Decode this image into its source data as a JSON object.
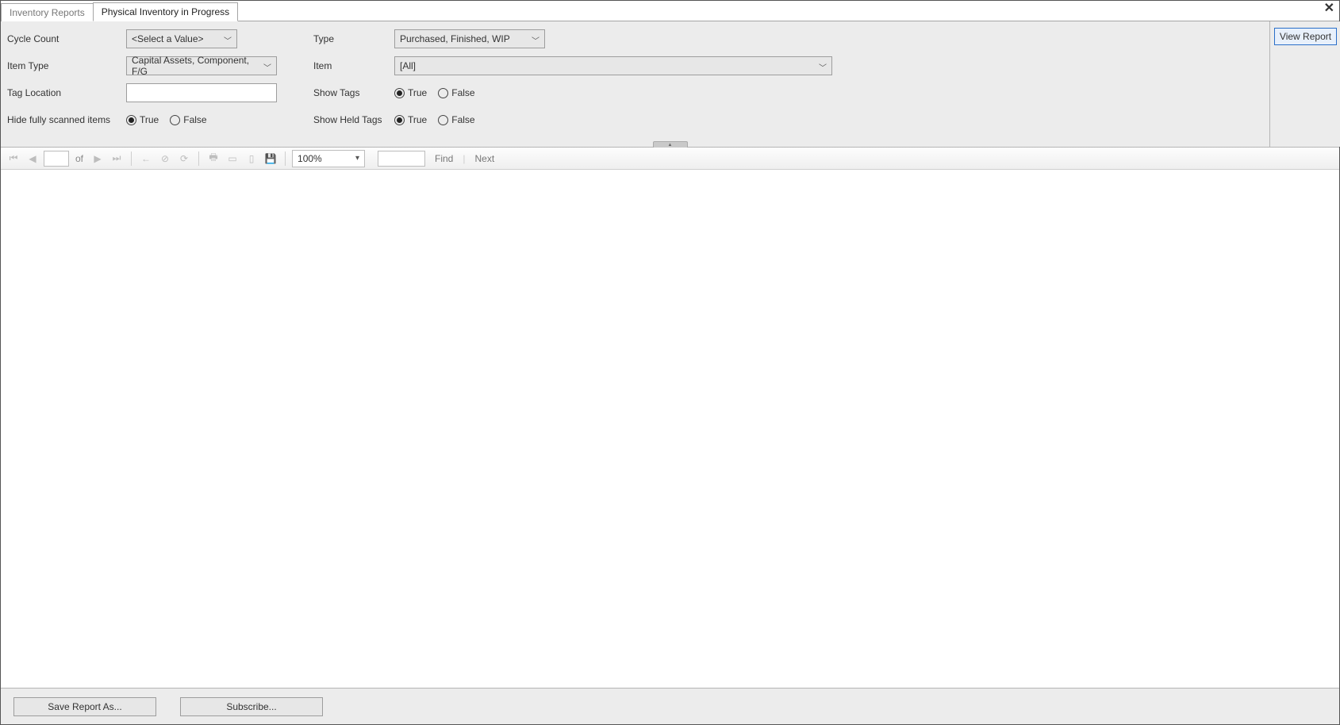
{
  "tabs": {
    "tab1": "Inventory Reports",
    "tab2": "Physical Inventory in Progress",
    "close": "✕"
  },
  "filters": {
    "labels": {
      "cycle_count": "Cycle Count",
      "item_type": "Item Type",
      "tag_location": "Tag Location",
      "hide_scanned": "Hide fully scanned items",
      "type": "Type",
      "item": "Item",
      "show_tags": "Show Tags",
      "show_held_tags": "Show Held Tags"
    },
    "values": {
      "cycle_count": "<Select a Value>",
      "item_type": "Capital Assets, Component, F/G",
      "tag_location": "",
      "type": "Purchased, Finished, WIP",
      "item": "[All]"
    },
    "radio": {
      "true": "True",
      "false": "False"
    },
    "view_report": "View Report"
  },
  "toolbar": {
    "of": "of",
    "zoom": "100%",
    "find": "Find",
    "next": "Next"
  },
  "footer": {
    "save_as": "Save Report As...",
    "subscribe": "Subscribe..."
  }
}
